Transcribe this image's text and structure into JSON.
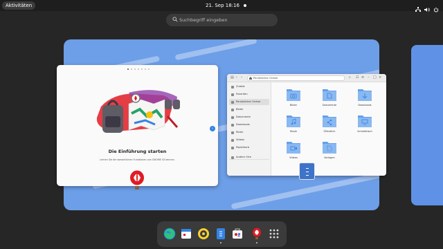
{
  "topbar": {
    "activities_label": "Aktivitäten",
    "clock": "21. Sep  18:16",
    "tray_icons": [
      "network-icon",
      "volume-icon",
      "power-icon"
    ]
  },
  "search": {
    "placeholder": "Suchbegriff eingeben"
  },
  "tour_window": {
    "title": "Die Einführung starten",
    "subtitle": "Lernen Sie die wesentlichen Funktionen von GNOME 43 kennen.",
    "page_count": 7,
    "current_page": 1
  },
  "files_window": {
    "path": "Persönlicher Ordner",
    "sidebar": [
      {
        "label": "Zuletzt",
        "icon": "clock-icon"
      },
      {
        "label": "Favoriten",
        "icon": "star-icon"
      },
      {
        "label": "Persönlicher Ordner",
        "icon": "home-icon",
        "selected": true
      },
      {
        "label": "Bilder",
        "icon": "image-icon"
      },
      {
        "label": "Dokumente",
        "icon": "document-icon"
      },
      {
        "label": "Downloads",
        "icon": "download-icon"
      },
      {
        "label": "Musik",
        "icon": "music-icon"
      },
      {
        "label": "Videos",
        "icon": "video-icon"
      },
      {
        "label": "Papierkorb",
        "icon": "trash-icon"
      },
      {
        "label": "Andere Orte",
        "icon": "plus-icon"
      }
    ],
    "folders": [
      {
        "label": "Bilder",
        "icon": "camera-icon"
      },
      {
        "label": "Dokumente",
        "icon": "document-icon"
      },
      {
        "label": "Downloads",
        "icon": "download-icon"
      },
      {
        "label": "Musik",
        "icon": "music-icon"
      },
      {
        "label": "Öffentlich",
        "icon": "share-icon"
      },
      {
        "label": "Schreibtisch",
        "icon": "desktop-icon"
      },
      {
        "label": "Videos",
        "icon": "video-icon"
      },
      {
        "label": "Vorlagen",
        "icon": "template-icon"
      }
    ]
  },
  "dock": {
    "apps": [
      "web-browser-icon",
      "calendar-icon",
      "rhythmbox-icon",
      "files-icon",
      "software-icon",
      "tour-icon",
      "app-grid-icon"
    ],
    "running": [
      "files-icon",
      "tour-icon"
    ]
  },
  "colors": {
    "accent": "#3584e4",
    "folder": "#62a0ea",
    "wallpaper": "#6d9ee8"
  }
}
